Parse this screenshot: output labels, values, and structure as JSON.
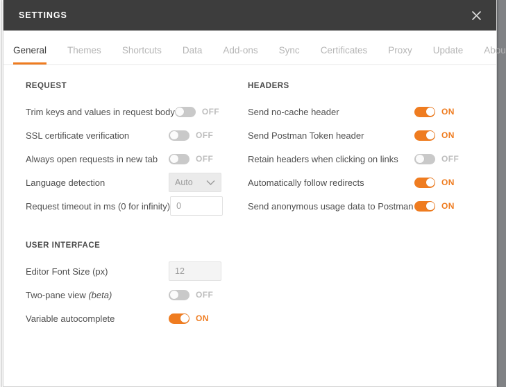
{
  "window": {
    "title": "SETTINGS",
    "close_icon": "close-icon",
    "accent_color": "#ef7c20",
    "titlebar_color": "#3d3d3d"
  },
  "tabs": [
    {
      "label": "General",
      "active": true
    },
    {
      "label": "Themes",
      "active": false
    },
    {
      "label": "Shortcuts",
      "active": false
    },
    {
      "label": "Data",
      "active": false
    },
    {
      "label": "Add-ons",
      "active": false
    },
    {
      "label": "Sync",
      "active": false
    },
    {
      "label": "Certificates",
      "active": false
    },
    {
      "label": "Proxy",
      "active": false
    },
    {
      "label": "Update",
      "active": false
    },
    {
      "label": "About",
      "active": false
    }
  ],
  "sections": {
    "request": {
      "title": "REQUEST",
      "rows": [
        {
          "label": "Trim keys and values in request body",
          "control": "toggle",
          "state": "OFF",
          "on": false
        },
        {
          "label": "SSL certificate verification",
          "control": "toggle",
          "state": "OFF",
          "on": false
        },
        {
          "label": "Always open requests in new tab",
          "control": "toggle",
          "state": "OFF",
          "on": false
        },
        {
          "label": "Language detection",
          "control": "select",
          "value": "Auto",
          "caret_icon": "chevron-down-icon"
        },
        {
          "label": "Request timeout in ms (0 for infinity)",
          "control": "input",
          "value": "0",
          "placeholder": "0"
        }
      ]
    },
    "user_interface": {
      "title": "USER INTERFACE",
      "rows": [
        {
          "label": "Editor Font Size (px)",
          "control": "input",
          "value": "12",
          "placeholder": "12"
        },
        {
          "label": "Two-pane view ",
          "label_italic": "(beta)",
          "control": "toggle",
          "state": "OFF",
          "on": false
        },
        {
          "label": "Variable autocomplete",
          "control": "toggle",
          "state": "ON",
          "on": true
        }
      ]
    },
    "headers": {
      "title": "HEADERS",
      "rows": [
        {
          "label": "Send no-cache header",
          "control": "toggle",
          "state": "ON",
          "on": true
        },
        {
          "label": "Send Postman Token header",
          "control": "toggle",
          "state": "ON",
          "on": true
        },
        {
          "label": "Retain headers when clicking on links",
          "control": "toggle",
          "state": "OFF",
          "on": false
        },
        {
          "label": "Automatically follow redirects",
          "control": "toggle",
          "state": "ON",
          "on": true
        },
        {
          "label": "Send anonymous usage data to Postman",
          "control": "toggle",
          "state": "ON",
          "on": true
        }
      ]
    }
  }
}
